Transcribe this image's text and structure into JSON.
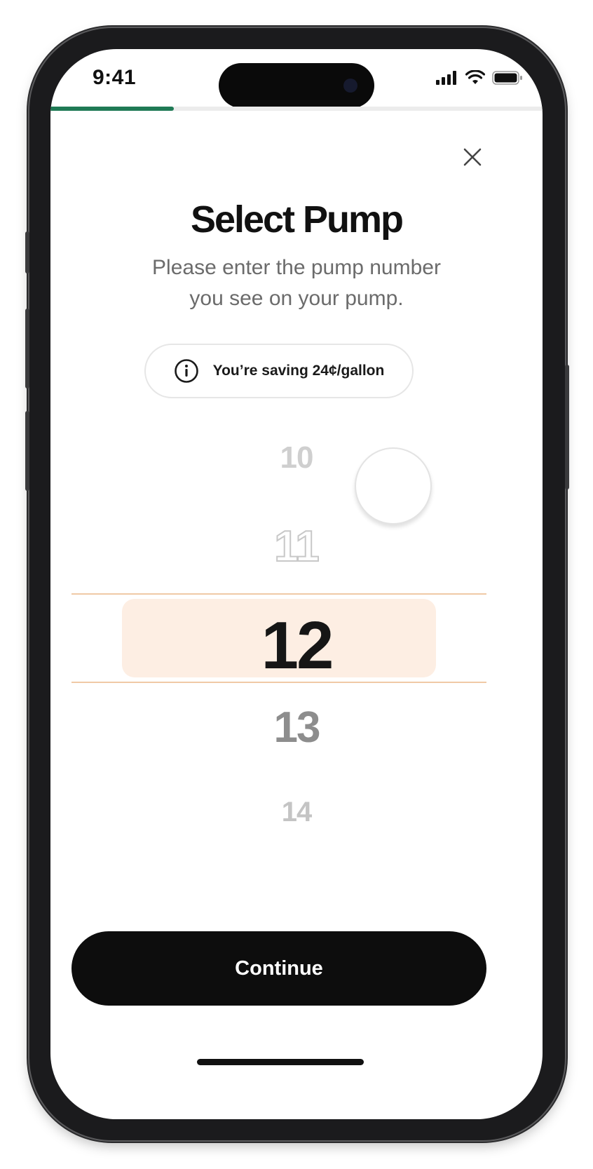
{
  "status_bar": {
    "time": "9:41"
  },
  "progress": {
    "fraction": 0.25,
    "color": "#1f7a55"
  },
  "header": {
    "close_icon": "close-icon"
  },
  "main": {
    "title": "Select Pump",
    "subtitle_line1": "Please enter the pump number",
    "subtitle_line2": "you see on your pump.",
    "savings": {
      "icon": "info-icon",
      "text": "You’re saving 24¢/gallon"
    }
  },
  "picker": {
    "options": [
      "10",
      "11",
      "12",
      "13",
      "14"
    ],
    "selected": "12",
    "highlight_color": "#fdeee3",
    "line_color": "#f0c9a6"
  },
  "footer": {
    "continue_label": "Continue"
  }
}
